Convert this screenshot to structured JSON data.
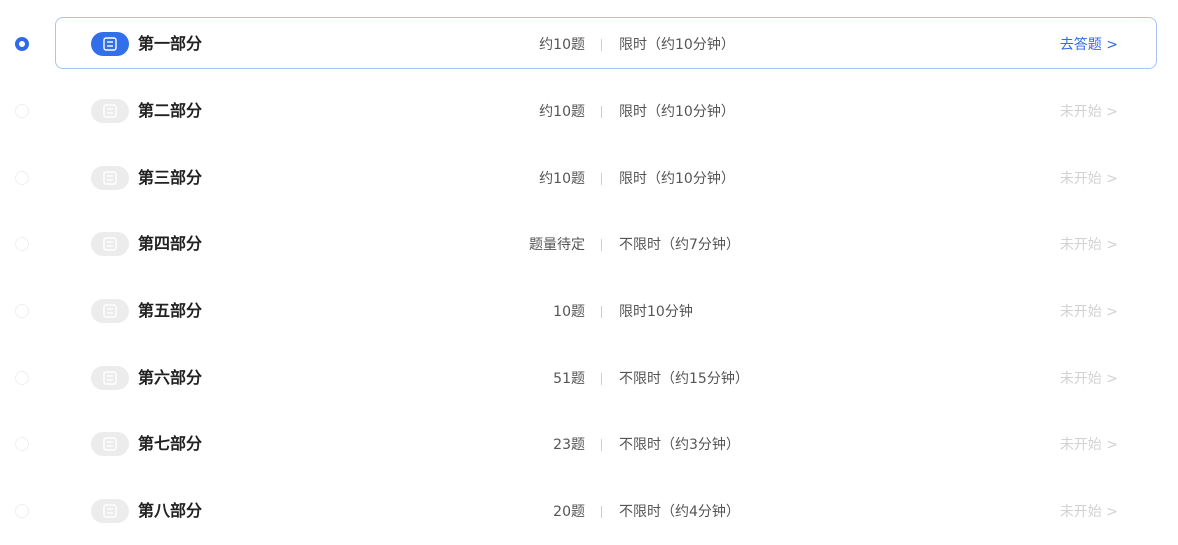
{
  "accent_color": "#2f6be8",
  "sections": [
    {
      "title": "第一部分",
      "count": "约10题",
      "time": "限时（约10分钟）",
      "action": "去答题 >",
      "active": true,
      "icon": "list-icon"
    },
    {
      "title": "第二部分",
      "count": "约10题",
      "time": "限时（约10分钟）",
      "action": "未开始 >",
      "active": false,
      "icon": "list-icon"
    },
    {
      "title": "第三部分",
      "count": "约10题",
      "time": "限时（约10分钟）",
      "action": "未开始 >",
      "active": false,
      "icon": "list-icon"
    },
    {
      "title": "第四部分",
      "count": "题量待定",
      "time": "不限时（约7分钟）",
      "action": "未开始 >",
      "active": false,
      "icon": "list-icon"
    },
    {
      "title": "第五部分",
      "count": "10题",
      "time": "限时10分钟",
      "action": "未开始 >",
      "active": false,
      "icon": "list-icon"
    },
    {
      "title": "第六部分",
      "count": "51题",
      "time": "不限时（约15分钟）",
      "action": "未开始 >",
      "active": false,
      "icon": "list-icon"
    },
    {
      "title": "第七部分",
      "count": "23题",
      "time": "不限时（约3分钟）",
      "action": "未开始 >",
      "active": false,
      "icon": "list-icon"
    },
    {
      "title": "第八部分",
      "count": "20题",
      "time": "不限时（约4分钟）",
      "action": "未开始 >",
      "active": false,
      "icon": "list-icon"
    }
  ]
}
